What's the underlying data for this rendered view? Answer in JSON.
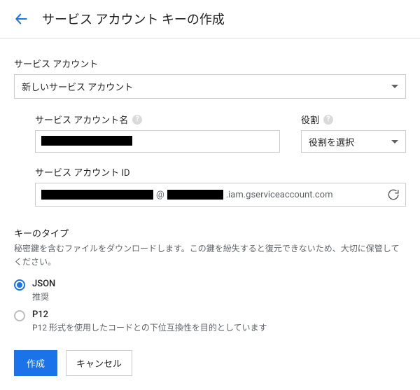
{
  "header": {
    "title": "サービス アカウント キーの作成"
  },
  "serviceAccount": {
    "label": "サービス アカウント",
    "selected": "新しいサービス アカウント"
  },
  "nameField": {
    "label": "サービス アカウント名",
    "value": "██████████"
  },
  "roleField": {
    "label": "役割",
    "selected": "役割を選択"
  },
  "idField": {
    "label": "サービス アカウント ID",
    "value": "████████████",
    "at": "@",
    "domainRedacted": "████████",
    "suffix": ".iam.gserviceaccount.com"
  },
  "keyType": {
    "title": "キーのタイプ",
    "desc": "秘密鍵を含むファイルをダウンロードします。この鍵を紛失すると復元できないため、大切に保管してください。",
    "options": [
      {
        "label": "JSON",
        "sub": "推奨",
        "selected": true
      },
      {
        "label": "P12",
        "sub": "P12 形式を使用したコードとの下位互換性を目的としています",
        "selected": false
      }
    ]
  },
  "actions": {
    "create": "作成",
    "cancel": "キャンセル"
  }
}
